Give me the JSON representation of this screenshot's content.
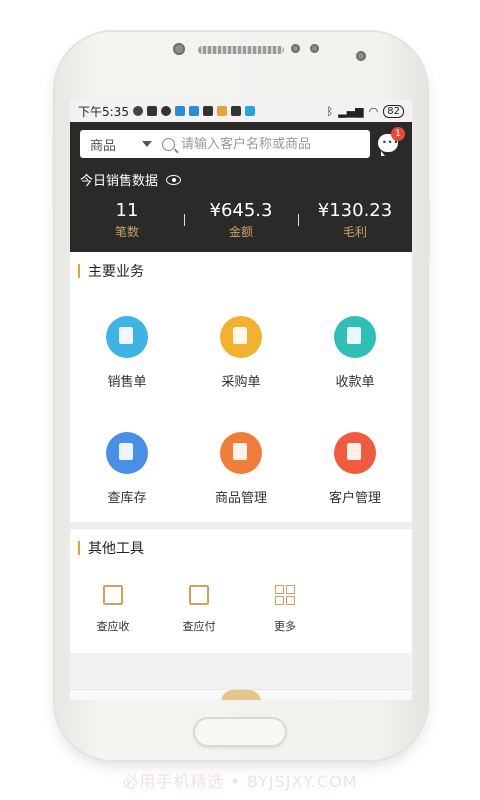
{
  "status": {
    "time": "下午5:35",
    "battery": "82"
  },
  "search": {
    "category": "商品",
    "placeholder": "请输入客户名称或商品"
  },
  "messages": {
    "badge": "1"
  },
  "summary": {
    "title": "今日销售数据",
    "stats": [
      {
        "value": "11",
        "label": "笔数"
      },
      {
        "value": "¥645.3",
        "label": "金额"
      },
      {
        "value": "¥130.23",
        "label": "毛利"
      }
    ]
  },
  "main_business": {
    "title": "主要业务",
    "items": [
      {
        "label": "销售单",
        "icon": "sales-order-icon",
        "color": "#3fb4e3"
      },
      {
        "label": "采购单",
        "icon": "purchase-order-icon",
        "color": "#f2b230"
      },
      {
        "label": "收款单",
        "icon": "receipt-icon",
        "color": "#2fbfb4"
      },
      {
        "label": "查库存",
        "icon": "warehouse-icon",
        "color": "#4a8fe6"
      },
      {
        "label": "商品管理",
        "icon": "shopping-bag-icon",
        "color": "#f07e3b"
      },
      {
        "label": "客户管理",
        "icon": "customer-icon",
        "color": "#ee5b3e"
      }
    ]
  },
  "other_tools": {
    "title": "其他工具",
    "items": [
      {
        "label": "查应收",
        "icon": "receivable-search-icon"
      },
      {
        "label": "查应付",
        "icon": "payable-search-icon"
      },
      {
        "label": "更多",
        "icon": "grid-more-icon"
      }
    ]
  },
  "colors": {
    "accent": "#d9a441",
    "header_bg": "#2b2a28",
    "stat_label": "#c8a46a"
  },
  "watermark": "必用手机精选 • BYJSJXY.COM"
}
